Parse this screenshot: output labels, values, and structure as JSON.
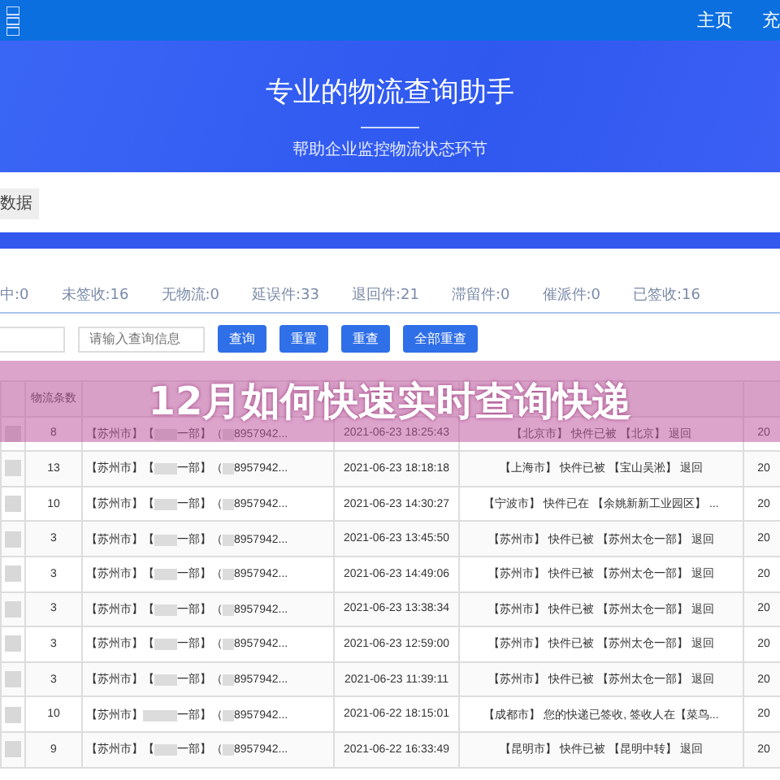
{
  "nav": {
    "items": [
      {
        "label": "主页"
      },
      {
        "label": "充"
      }
    ]
  },
  "hero": {
    "title": "专业的物流查询助手",
    "subtitle": "帮助企业监控物流状态环节"
  },
  "tab": {
    "label": "数据"
  },
  "stats": [
    "中:0",
    "未签收:16",
    "无物流:0",
    "延误件:33",
    "退回件:21",
    "滞留件:0",
    "催派件:0",
    "已签收:16"
  ],
  "search": {
    "placeholder": "请输入查询信息",
    "buttons": [
      "查询",
      "重置",
      "重查",
      "全部重查"
    ]
  },
  "banner": {
    "title": "12月如何快速实时查询快递"
  },
  "table": {
    "columns": [
      "物流条数"
    ],
    "rows": [
      {
        "count": "8",
        "sender": "【苏州市】【　　一部】（　8957942...",
        "time": "2021-06-23 18:25:43",
        "info": "【北京市】 快件已被 【北京】 退回",
        "column_5": "20"
      },
      {
        "count": "13",
        "sender": "【苏州市】【　　一部】（　8957942...",
        "time": "2021-06-23 18:18:18",
        "info": "【上海市】 快件已被 【宝山吴淞】 退回",
        "column_5": "20"
      },
      {
        "count": "10",
        "sender": "【苏州市】【　　一部】（　8957942...",
        "time": "2021-06-23 14:30:27",
        "info": "【宁波市】 快件已在 【余姚新新工业园区】 ...",
        "column_5": "20"
      },
      {
        "count": "3",
        "sender": "【苏州市】【　　一部】（　8957942...",
        "time": "2021-06-23 13:45:50",
        "info": "【苏州市】 快件已被 【苏州太仓一部】 退回",
        "column_5": "20"
      },
      {
        "count": "3",
        "sender": "【苏州市】【　　一部】（　8957942...",
        "time": "2021-06-23 14:49:06",
        "info": "【苏州市】 快件已被 【苏州太仓一部】 退回",
        "column_5": "20"
      },
      {
        "count": "3",
        "sender": "【苏州市】【　　一部】（　8957942...",
        "time": "2021-06-23 13:38:34",
        "info": "【苏州市】 快件已被 【苏州太仓一部】 退回",
        "column_5": "20"
      },
      {
        "count": "3",
        "sender": "【苏州市】【　　一部】（　8957942...",
        "time": "2021-06-23 12:59:00",
        "info": "【苏州市】 快件已被 【苏州太仓一部】 退回",
        "column_5": "20"
      },
      {
        "count": "3",
        "sender": "【苏州市】【　　一部】（　8957942...",
        "time": "2021-06-23 11:39:11",
        "info": "【苏州市】 快件已被 【苏州太仓一部】 退回",
        "column_5": "20"
      },
      {
        "count": "10",
        "sender": "【苏州市】　　　一部】（　8957942...",
        "time": "2021-06-22 18:15:01",
        "info": "【成都市】 您的快递已签收, 签收人在【菜鸟...",
        "column_5": "20"
      },
      {
        "count": "9",
        "sender": "【苏州市】【　　一部】（　8957942...",
        "time": "2021-06-22 16:33:49",
        "info": "【昆明市】 快件已被 【昆明中转】 退回",
        "column_5": "20"
      }
    ]
  }
}
